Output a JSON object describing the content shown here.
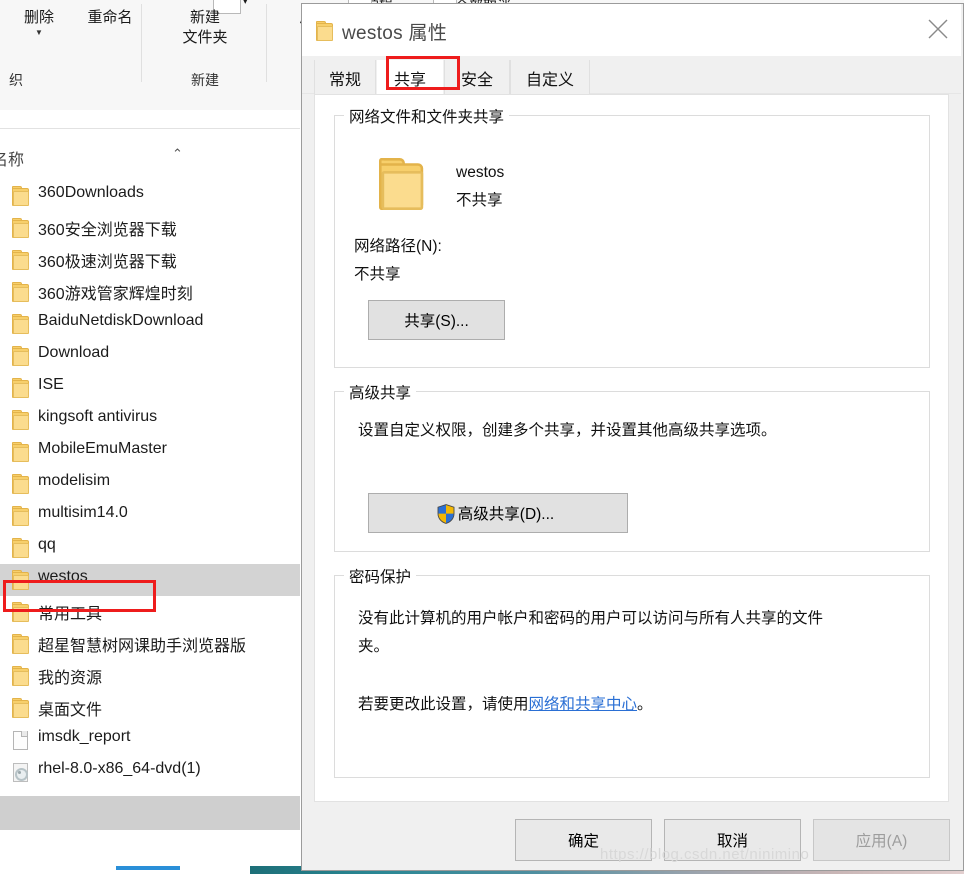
{
  "explorer": {
    "ribbon": {
      "commands": [
        {
          "label": "删除",
          "has_caret": true
        },
        {
          "label": "重命名",
          "has_caret": false
        },
        {
          "label": "新建\n文件夹",
          "has_caret": false
        }
      ],
      "delete_label": "删除",
      "rename_label": "重命名",
      "new_folder_label_line1": "新建",
      "new_folder_label_line2": "文件夹",
      "properties_label": "属",
      "group_organize": "织",
      "group_new": "新建",
      "clipped_edit": "编辑",
      "clipped_select_none": "全部取消"
    },
    "list": {
      "column_header": "名称",
      "sort_indicator": "⌃",
      "items": [
        {
          "name": "360Downloads",
          "icon": "folder-icon",
          "selected": false
        },
        {
          "name": "360安全浏览器下载",
          "icon": "folder-icon",
          "selected": false
        },
        {
          "name": "360极速浏览器下载",
          "icon": "folder-icon",
          "selected": false
        },
        {
          "name": "360游戏管家辉煌时刻",
          "icon": "folder-icon",
          "selected": false
        },
        {
          "name": "BaiduNetdiskDownload",
          "icon": "folder-icon",
          "selected": false
        },
        {
          "name": "Download",
          "icon": "folder-icon",
          "selected": false
        },
        {
          "name": "ISE",
          "icon": "folder-icon",
          "selected": false
        },
        {
          "name": "kingsoft antivirus",
          "icon": "folder-icon",
          "selected": false
        },
        {
          "name": "MobileEmuMaster",
          "icon": "folder-icon",
          "selected": false
        },
        {
          "name": "modelisim",
          "icon": "folder-icon",
          "selected": false
        },
        {
          "name": "multisim14.0",
          "icon": "folder-icon",
          "selected": false
        },
        {
          "name": "qq",
          "icon": "folder-icon",
          "selected": false
        },
        {
          "name": "westos",
          "icon": "folder-icon",
          "selected": true
        },
        {
          "name": "常用工具",
          "icon": "folder-icon",
          "selected": false
        },
        {
          "name": "超星智慧树网课助手浏览器版",
          "icon": "folder-icon",
          "selected": false
        },
        {
          "name": "我的资源",
          "icon": "folder-icon",
          "selected": false
        },
        {
          "name": "桌面文件",
          "icon": "folder-icon",
          "selected": false
        },
        {
          "name": "imsdk_report",
          "icon": "file-icon",
          "selected": false
        },
        {
          "name": "rhel-8.0-x86_64-dvd(1)",
          "icon": "disc-image-icon",
          "selected": false
        }
      ]
    }
  },
  "dialog": {
    "title": "westos 属性",
    "close_icon": "close-icon",
    "folder_icon": "folder-icon",
    "tabs": [
      {
        "label": "常规",
        "active": false
      },
      {
        "label": "共享",
        "active": true
      },
      {
        "label": "安全",
        "active": false
      },
      {
        "label": "自定义",
        "active": false
      }
    ],
    "network_share": {
      "group_title": "网络文件和文件夹共享",
      "folder_icon": "folder-icon",
      "folder_name": "westos",
      "share_state": "不共享",
      "path_label": "网络路径(N):",
      "path_value": "不共享",
      "share_button": "共享(S)..."
    },
    "advanced_share": {
      "group_title": "高级共享",
      "description": "设置自定义权限，创建多个共享，并设置其他高级共享选项。",
      "button_label": "高级共享(D)...",
      "button_icon": "uac-shield-icon"
    },
    "password_protection": {
      "group_title": "密码保护",
      "line1": "没有此计算机的用户帐户和密码的用户可以访问与所有人共享的文件",
      "line2": "夹。",
      "line3_prefix": "若要更改此设置，请使用",
      "line3_link": "网络和共享中心",
      "line3_suffix": "。"
    },
    "footer": {
      "ok": "确定",
      "cancel": "取消",
      "apply": "应用(A)",
      "apply_disabled": true
    }
  },
  "watermark": "https://blog.csdn.net/ninimino",
  "colors": {
    "accent_red": "#ee1c1c",
    "link_blue": "#2a6fd4",
    "selection_gray": "#d3d3d3",
    "dialog_bg": "#f0f0f0"
  }
}
